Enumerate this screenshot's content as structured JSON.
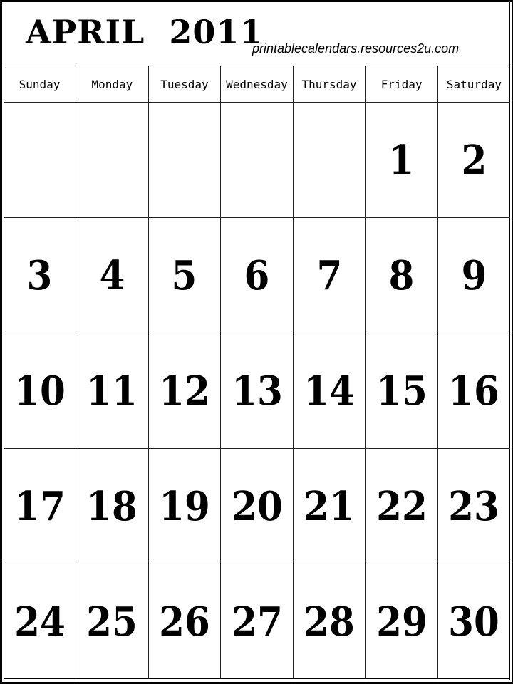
{
  "calendar": {
    "title": "APRIL  2011",
    "month": "APRIL",
    "year": "2011",
    "website": "printablecalendars.resources2u.com",
    "weekdays": [
      "Sunday",
      "Monday",
      "Tuesday",
      "Wednesday",
      "Thursday",
      "Friday",
      "Saturday"
    ],
    "weeks": [
      [
        "",
        "",
        "",
        "",
        "",
        "1",
        "2"
      ],
      [
        "3",
        "4",
        "5",
        "6",
        "7",
        "8",
        "9"
      ],
      [
        "10",
        "11",
        "12",
        "13",
        "14",
        "15",
        "16"
      ],
      [
        "17",
        "18",
        "19",
        "20",
        "21",
        "22",
        "23"
      ],
      [
        "24",
        "25",
        "26",
        "27",
        "28",
        "29",
        "30"
      ]
    ]
  }
}
